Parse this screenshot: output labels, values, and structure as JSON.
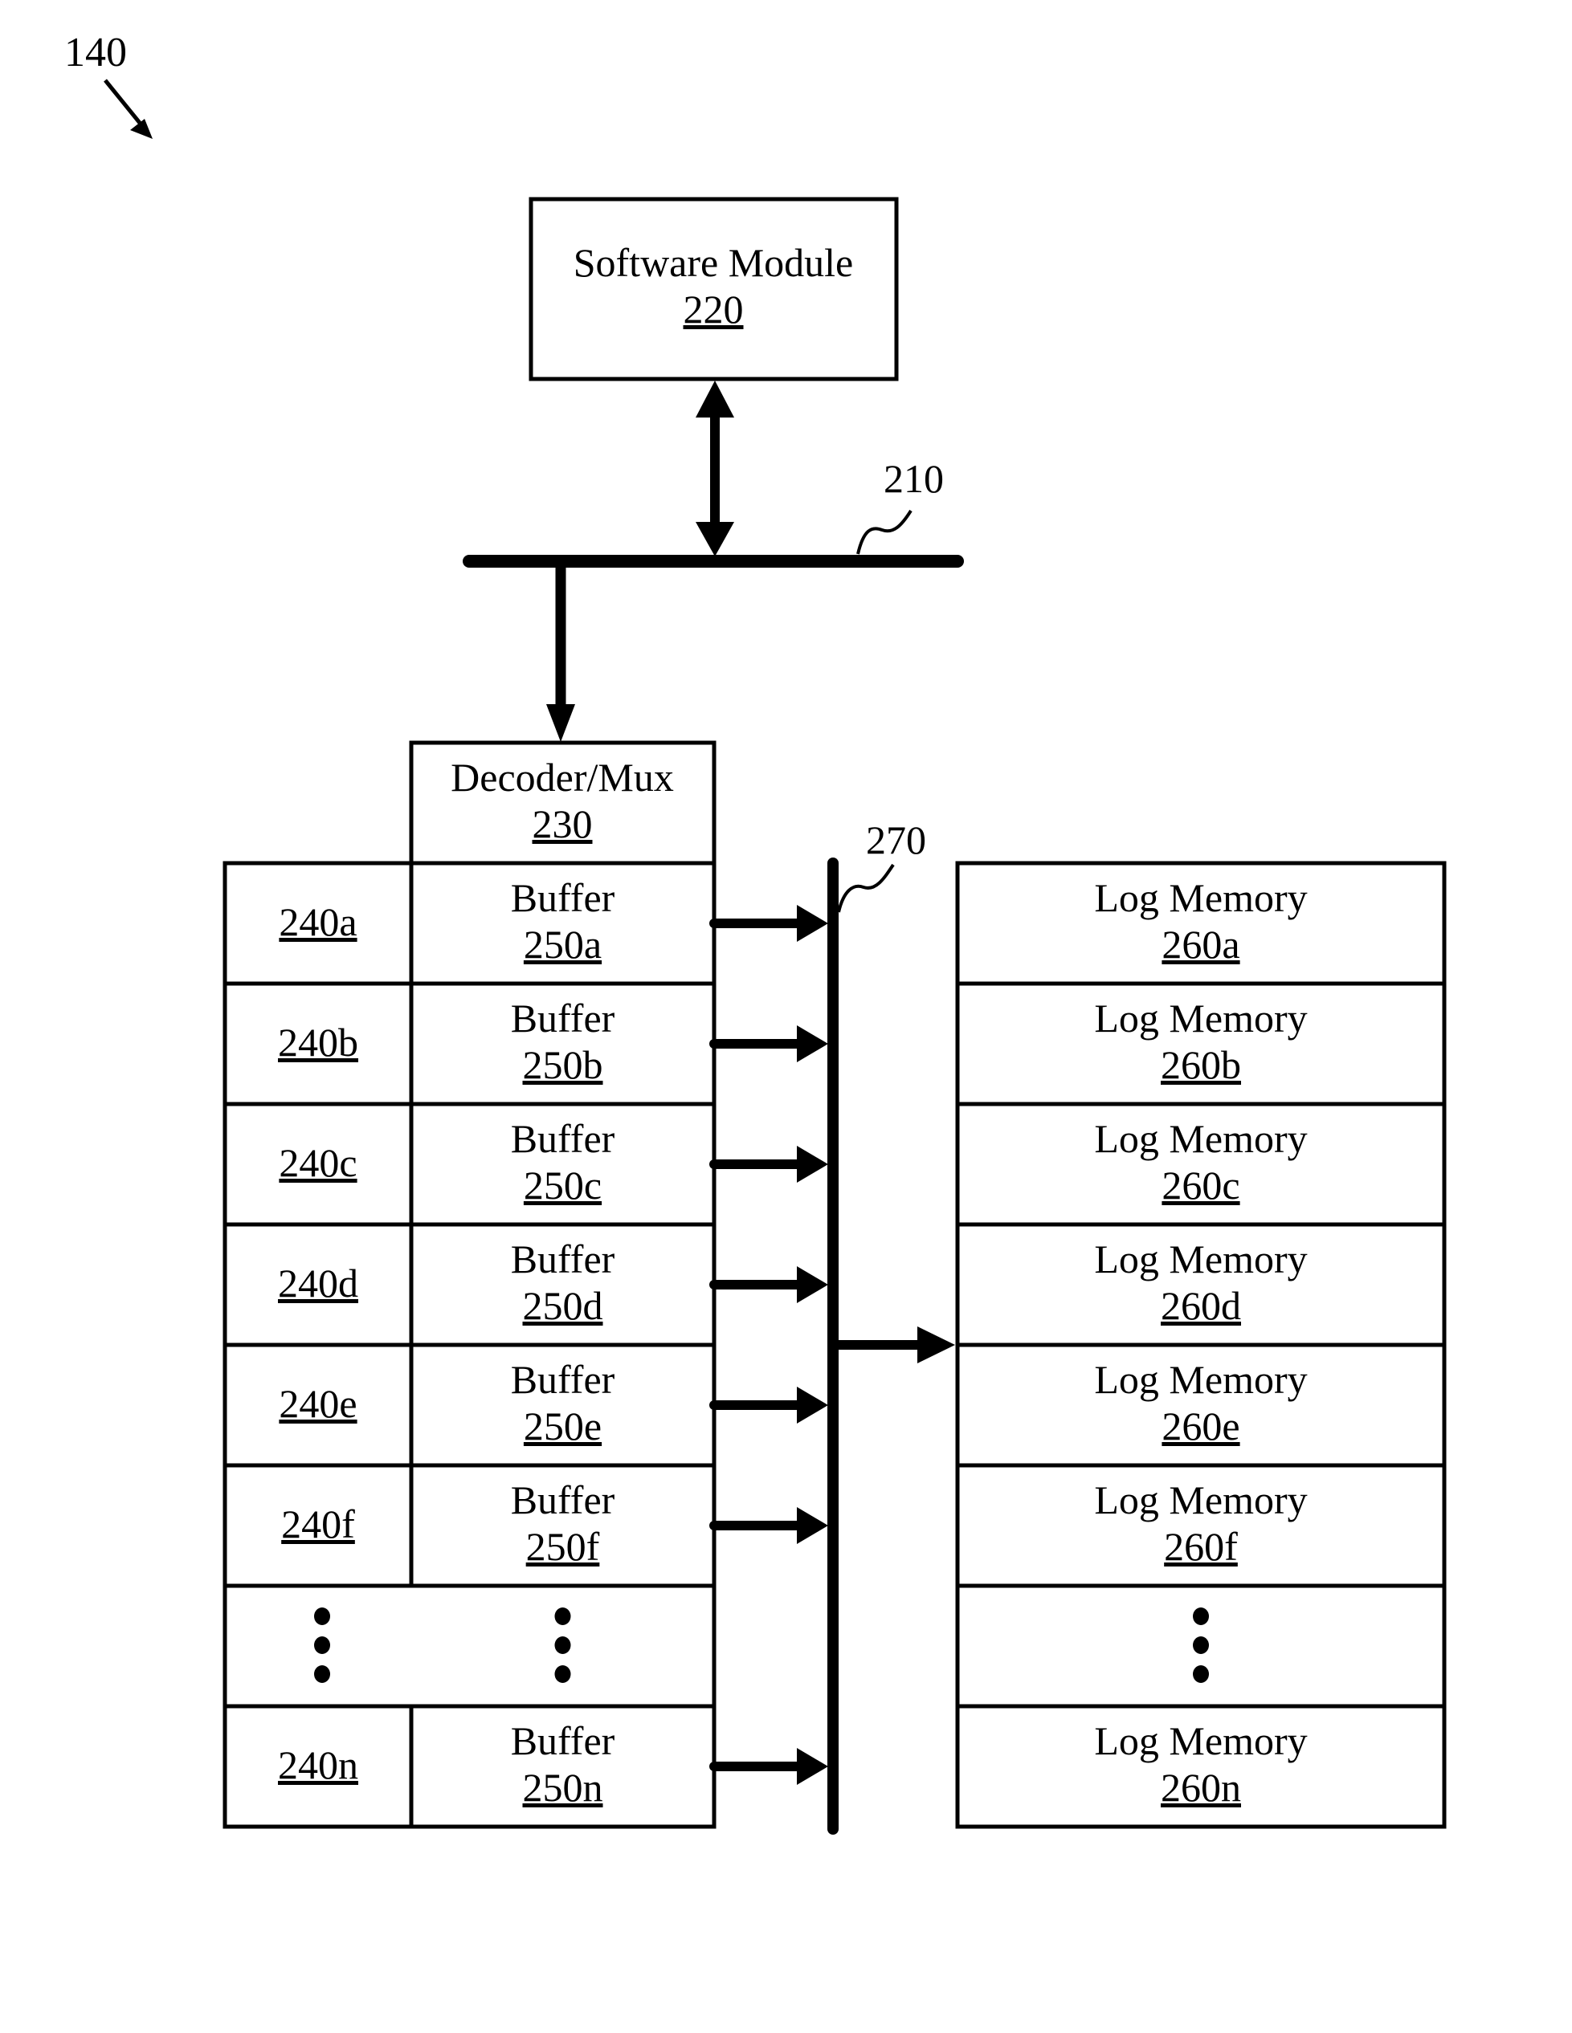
{
  "figure": {
    "ref_label": "140",
    "software_module": {
      "title": "Software Module",
      "ref": "220"
    },
    "bus_top": {
      "ref": "210"
    },
    "decoder": {
      "title": "Decoder/Mux",
      "ref": "230"
    },
    "bus_right": {
      "ref": "270"
    },
    "rows": [
      {
        "id_ref": "240a",
        "buffer_title": "Buffer",
        "buffer_ref": "250a",
        "log_title": "Log Memory",
        "log_ref": "260a"
      },
      {
        "id_ref": "240b",
        "buffer_title": "Buffer",
        "buffer_ref": "250b",
        "log_title": "Log Memory",
        "log_ref": "260b"
      },
      {
        "id_ref": "240c",
        "buffer_title": "Buffer",
        "buffer_ref": "250c",
        "log_title": "Log Memory",
        "log_ref": "260c"
      },
      {
        "id_ref": "240d",
        "buffer_title": "Buffer",
        "buffer_ref": "250d",
        "log_title": "Log Memory",
        "log_ref": "260d"
      },
      {
        "id_ref": "240e",
        "buffer_title": "Buffer",
        "buffer_ref": "250e",
        "log_title": "Log Memory",
        "log_ref": "260e"
      },
      {
        "id_ref": "240f",
        "buffer_title": "Buffer",
        "buffer_ref": "250f",
        "log_title": "Log Memory",
        "log_ref": "260f"
      },
      {
        "ellipsis": true
      },
      {
        "id_ref": "240n",
        "buffer_title": "Buffer",
        "buffer_ref": "250n",
        "log_title": "Log Memory",
        "log_ref": "260n"
      }
    ],
    "colors": {
      "ink": "#000000",
      "background": "#ffffff"
    }
  }
}
